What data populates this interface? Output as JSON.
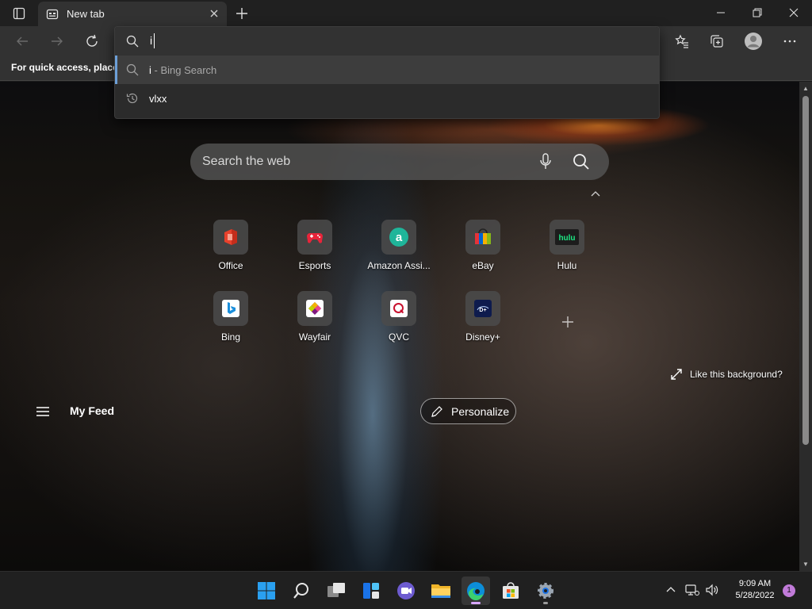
{
  "window": {
    "tab_title": "New tab"
  },
  "favorites_bar": {
    "hint": "For quick access, place y"
  },
  "omnibox": {
    "value": "i",
    "suggestions": [
      {
        "text": "i",
        "sub": " - Bing Search",
        "icon": "search-icon"
      },
      {
        "text": "vlxx",
        "sub": "",
        "icon": "history-icon"
      }
    ]
  },
  "new_tab_page": {
    "search_placeholder": "Search the web",
    "tiles": [
      {
        "label": "Office",
        "icon": "office-icon"
      },
      {
        "label": "Esports",
        "icon": "gamepad-icon"
      },
      {
        "label": "Amazon Assi...",
        "icon": "amazon-assistant-icon"
      },
      {
        "label": "eBay",
        "icon": "ebay-bag-icon"
      },
      {
        "label": "Hulu",
        "icon": "hulu-icon"
      },
      {
        "label": "Bing",
        "icon": "bing-icon"
      },
      {
        "label": "Wayfair",
        "icon": "wayfair-icon"
      },
      {
        "label": "QVC",
        "icon": "qvc-icon"
      },
      {
        "label": "Disney+",
        "icon": "disney-plus-icon"
      }
    ],
    "like_background": "Like this background?",
    "feed_title": "My Feed",
    "personalize_label": "Personalize"
  },
  "taskbar": {
    "time": "9:09 AM",
    "date": "5/28/2022",
    "notification_count": "1"
  },
  "colors": {
    "accent": "#6c9fd8",
    "taskbar_indicator": "#d7a6ff",
    "notification_badge": "#c17bd9"
  }
}
